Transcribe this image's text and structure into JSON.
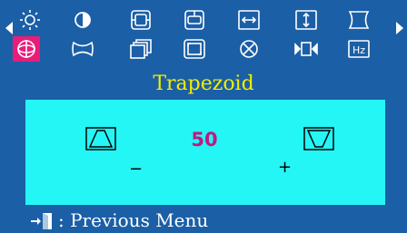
{
  "menu": {
    "row1_icons": [
      "brightness-icon",
      "contrast-icon",
      "horizontal-position-icon",
      "vertical-position-icon",
      "horizontal-size-icon",
      "vertical-size-icon",
      "pincushion-icon"
    ],
    "row2_icons": [
      "trapezoid-icon",
      "parallelogram-icon",
      "rotation-icon",
      "zoom-icon",
      "degauss-icon",
      "moire-icon",
      "h-frequency-icon"
    ],
    "row2_last_label": "Hz",
    "selected": "trapezoid-icon"
  },
  "title": "Trapezoid",
  "adjustment": {
    "value": "50",
    "decrease_label": "−",
    "increase_label": "+"
  },
  "footer": {
    "label": ": Previous Menu"
  },
  "colors": {
    "background": "#1b5fa6",
    "panel": "#24f6f6",
    "selected": "#ea1c79",
    "title": "#f5ec00",
    "value": "#c2187f"
  }
}
